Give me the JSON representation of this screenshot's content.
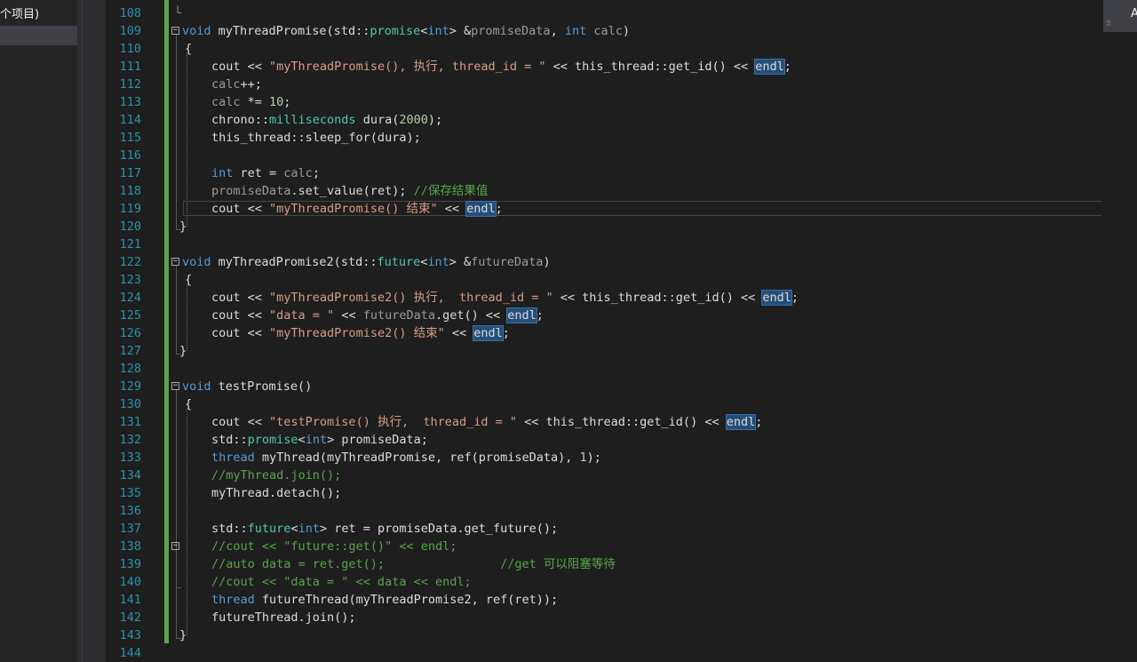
{
  "solution_explorer": {
    "project_label": "个项目)"
  },
  "corner_label": "A",
  "line_numbers": [
    "108",
    "109",
    "110",
    "111",
    "112",
    "113",
    "114",
    "115",
    "116",
    "117",
    "118",
    "119",
    "120",
    "121",
    "122",
    "123",
    "124",
    "125",
    "126",
    "127",
    "128",
    "129",
    "130",
    "131",
    "132",
    "133",
    "134",
    "135",
    "136",
    "137",
    "138",
    "139",
    "140",
    "141",
    "142",
    "143",
    "144"
  ],
  "code": {
    "l108": "└",
    "l109": [
      "void",
      " myThreadPromise(std::",
      "promise",
      "<",
      "int",
      "> &",
      "promiseData",
      ", ",
      "int",
      " ",
      "calc",
      ")"
    ],
    "l110": "{",
    "l111": [
      "cout << ",
      "\"myThreadPromise(), 执行, thread_id = \"",
      " << this_thread::get_id() << ",
      "endl",
      ";"
    ],
    "l112": [
      "calc",
      "++;"
    ],
    "l113": [
      "calc",
      " *= ",
      "10",
      ";"
    ],
    "l114": [
      "chrono::",
      "milliseconds",
      " dura(",
      "2000",
      ");"
    ],
    "l115": "this_thread::sleep_for(dura);",
    "l117": [
      "int",
      " ret = ",
      "calc",
      ";"
    ],
    "l118": [
      "promiseData",
      ".set_value(ret); ",
      "//保存结果值"
    ],
    "l119": [
      "cout << ",
      "\"myThreadPromise() 结束\"",
      " << ",
      "endl",
      ";"
    ],
    "l120": "}",
    "l122": [
      "void",
      " myThreadPromise2(std::",
      "future",
      "<",
      "int",
      "> &",
      "futureData",
      ")"
    ],
    "l123": "{",
    "l124": [
      "cout << ",
      "\"myThreadPromise2() 执行,  thread_id = \"",
      " << this_thread::get_id() << ",
      "endl",
      ";"
    ],
    "l125": [
      "cout << ",
      "\"data = \"",
      " << ",
      "futureData",
      ".get() << ",
      "endl",
      ";"
    ],
    "l126": [
      "cout << ",
      "\"myThreadPromise2() 结束\"",
      " << ",
      "endl",
      ";"
    ],
    "l127": "}",
    "l129": [
      "void",
      " testPromise()"
    ],
    "l130": "{",
    "l131": [
      "cout << ",
      "\"testPromise() 执行,  thread_id = \"",
      " << this_thread::get_id() << ",
      "endl",
      ";"
    ],
    "l132": [
      "std::",
      "promise",
      "<",
      "int",
      "> promiseData;"
    ],
    "l133": [
      "thread",
      " myThread(myThreadPromise, ref(promiseData), ",
      "1",
      ");"
    ],
    "l134": "//myThread.join();",
    "l135": "myThread.detach();",
    "l137": [
      "std::",
      "future",
      "<",
      "int",
      "> ret = promiseData.get_future();"
    ],
    "l138": "//cout << \"future::get()\" << endl;",
    "l139": "//auto data = ret.get();                //get 可以阻塞等待",
    "l140": "//cout << \"data = \" << data << endl;",
    "l141": [
      "thread",
      " futureThread(myThreadPromise2, ref(ret));"
    ],
    "l142": "futureThread.join();",
    "l143": "}"
  },
  "fold_markers": {
    "collapse": "−"
  },
  "colors": {
    "keyword": "#569cd6",
    "type": "#4ec9b0",
    "string": "#d69d85",
    "comment": "#57a64a",
    "number": "#b5cea8",
    "line_number": "#2b91af",
    "highlight": "#264f78",
    "change_bar": "#57a64a"
  }
}
